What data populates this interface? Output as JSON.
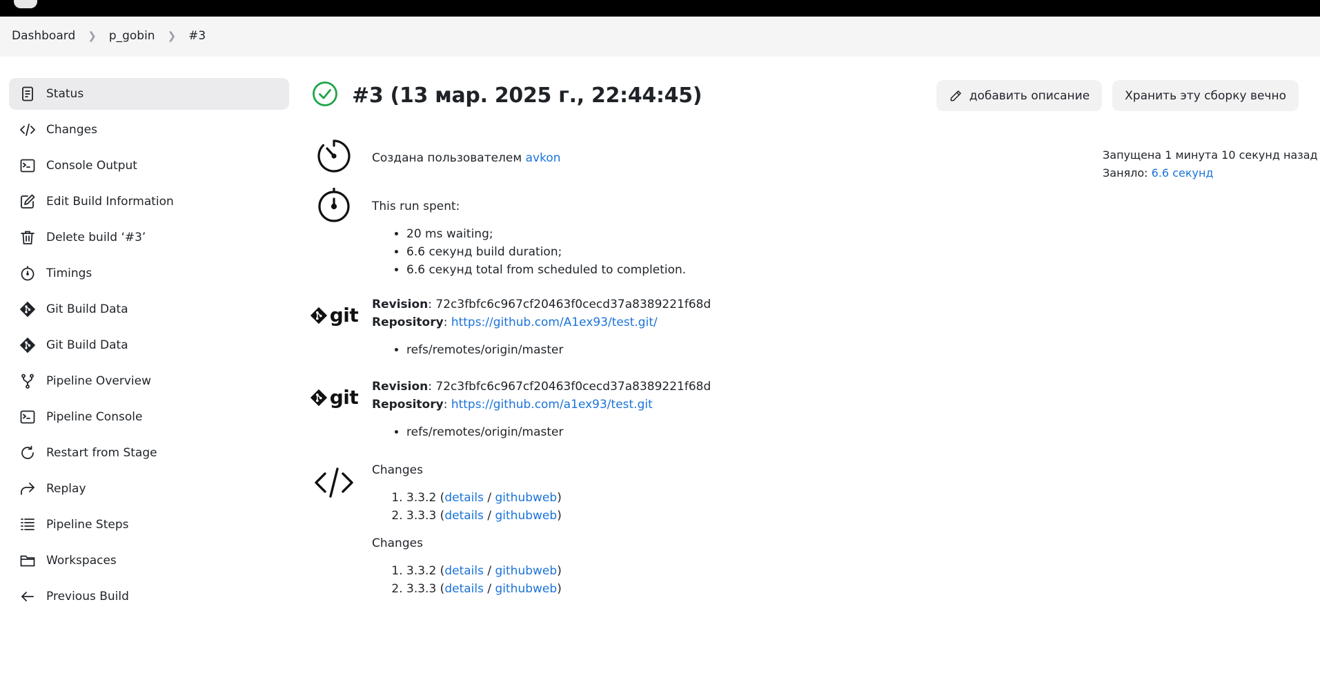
{
  "breadcrumbs": [
    "Dashboard",
    "p_gobin",
    "#3"
  ],
  "sidebar": {
    "items": [
      {
        "label": "Status",
        "icon": "document-icon",
        "active": true
      },
      {
        "label": "Changes",
        "icon": "code-icon"
      },
      {
        "label": "Console Output",
        "icon": "terminal-icon"
      },
      {
        "label": "Edit Build Information",
        "icon": "edit-icon"
      },
      {
        "label": "Delete build ‘#3’",
        "icon": "trash-icon"
      },
      {
        "label": "Timings",
        "icon": "stopwatch-icon"
      },
      {
        "label": "Git Build Data",
        "icon": "git-icon"
      },
      {
        "label": "Git Build Data",
        "icon": "git-icon"
      },
      {
        "label": "Pipeline Overview",
        "icon": "branch-icon"
      },
      {
        "label": "Pipeline Console",
        "icon": "terminal-icon"
      },
      {
        "label": "Restart from Stage",
        "icon": "restart-icon"
      },
      {
        "label": "Replay",
        "icon": "replay-icon"
      },
      {
        "label": "Pipeline Steps",
        "icon": "list-icon"
      },
      {
        "label": "Workspaces",
        "icon": "folder-icon"
      },
      {
        "label": "Previous Build",
        "icon": "arrow-left-icon"
      }
    ]
  },
  "header": {
    "title": "#3 (13 мар. 2025 г., 22:44:45)",
    "status_color": "#1ea446",
    "add_description_label": "добавить описание",
    "keep_forever_label": "Хранить эту сборку вечно"
  },
  "info": {
    "started_ago": "Запущена 1 минута 10 секунд назад",
    "took_label": "Заняло:",
    "took_value": "6.6 секунд"
  },
  "created": {
    "prefix": "Создана пользователем",
    "user": "avkon"
  },
  "timing": {
    "heading": "This run spent:",
    "items": [
      "20 ms waiting;",
      "6.6 секунд build duration;",
      "6.6 секунд total from scheduled to completion."
    ]
  },
  "git": [
    {
      "revision_label": "Revision",
      "revision": "72c3fbfc6c967cf20463f0cecd37a8389221f68d",
      "repository_label": "Repository",
      "repository": "https://github.com/A1ex93/test.git/",
      "refs": [
        "refs/remotes/origin/master"
      ]
    },
    {
      "revision_label": "Revision",
      "revision": "72c3fbfc6c967cf20463f0cecd37a8389221f68d",
      "repository_label": "Repository",
      "repository": "https://github.com/a1ex93/test.git",
      "refs": [
        "refs/remotes/origin/master"
      ]
    }
  ],
  "git_logo_text": "git",
  "changes": [
    {
      "heading": "Changes",
      "items": [
        {
          "version": "3.3.2",
          "details": "details",
          "githubweb": "githubweb"
        },
        {
          "version": "3.3.3",
          "details": "details",
          "githubweb": "githubweb"
        }
      ]
    },
    {
      "heading": "Changes",
      "items": [
        {
          "version": "3.3.2",
          "details": "details",
          "githubweb": "githubweb"
        },
        {
          "version": "3.3.3",
          "details": "details",
          "githubweb": "githubweb"
        }
      ]
    }
  ]
}
